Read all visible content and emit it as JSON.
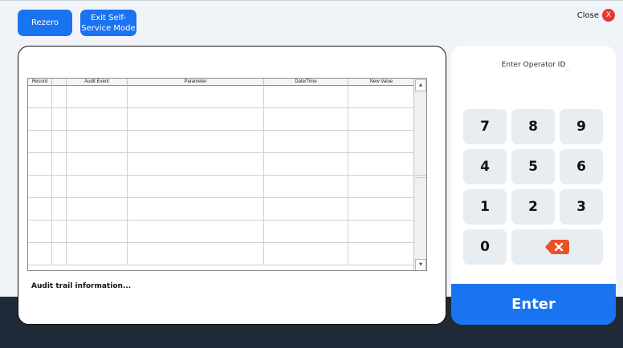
{
  "toolbar": {
    "rezero_label": "Rezero",
    "exit_line1": "Exit Self-",
    "exit_line2": "Service Mode",
    "close_label": "Close",
    "close_icon_glyph": "X"
  },
  "audit": {
    "columns": [
      "Record",
      "",
      "Audit Event",
      "Parameter",
      "Date/Time",
      "New Value"
    ],
    "info_text": "Audit trail information..."
  },
  "keypad": {
    "prompt": "Enter Operator ID",
    "keys": [
      "7",
      "8",
      "9",
      "4",
      "5",
      "6",
      "1",
      "2",
      "3",
      "0"
    ],
    "backspace_icon": "backspace-icon",
    "enter_label": "Enter"
  },
  "colors": {
    "accent": "#1a73f0",
    "close_red": "#e53935",
    "backspace_orange": "#e8522a",
    "dark_band": "#1f2a38"
  }
}
